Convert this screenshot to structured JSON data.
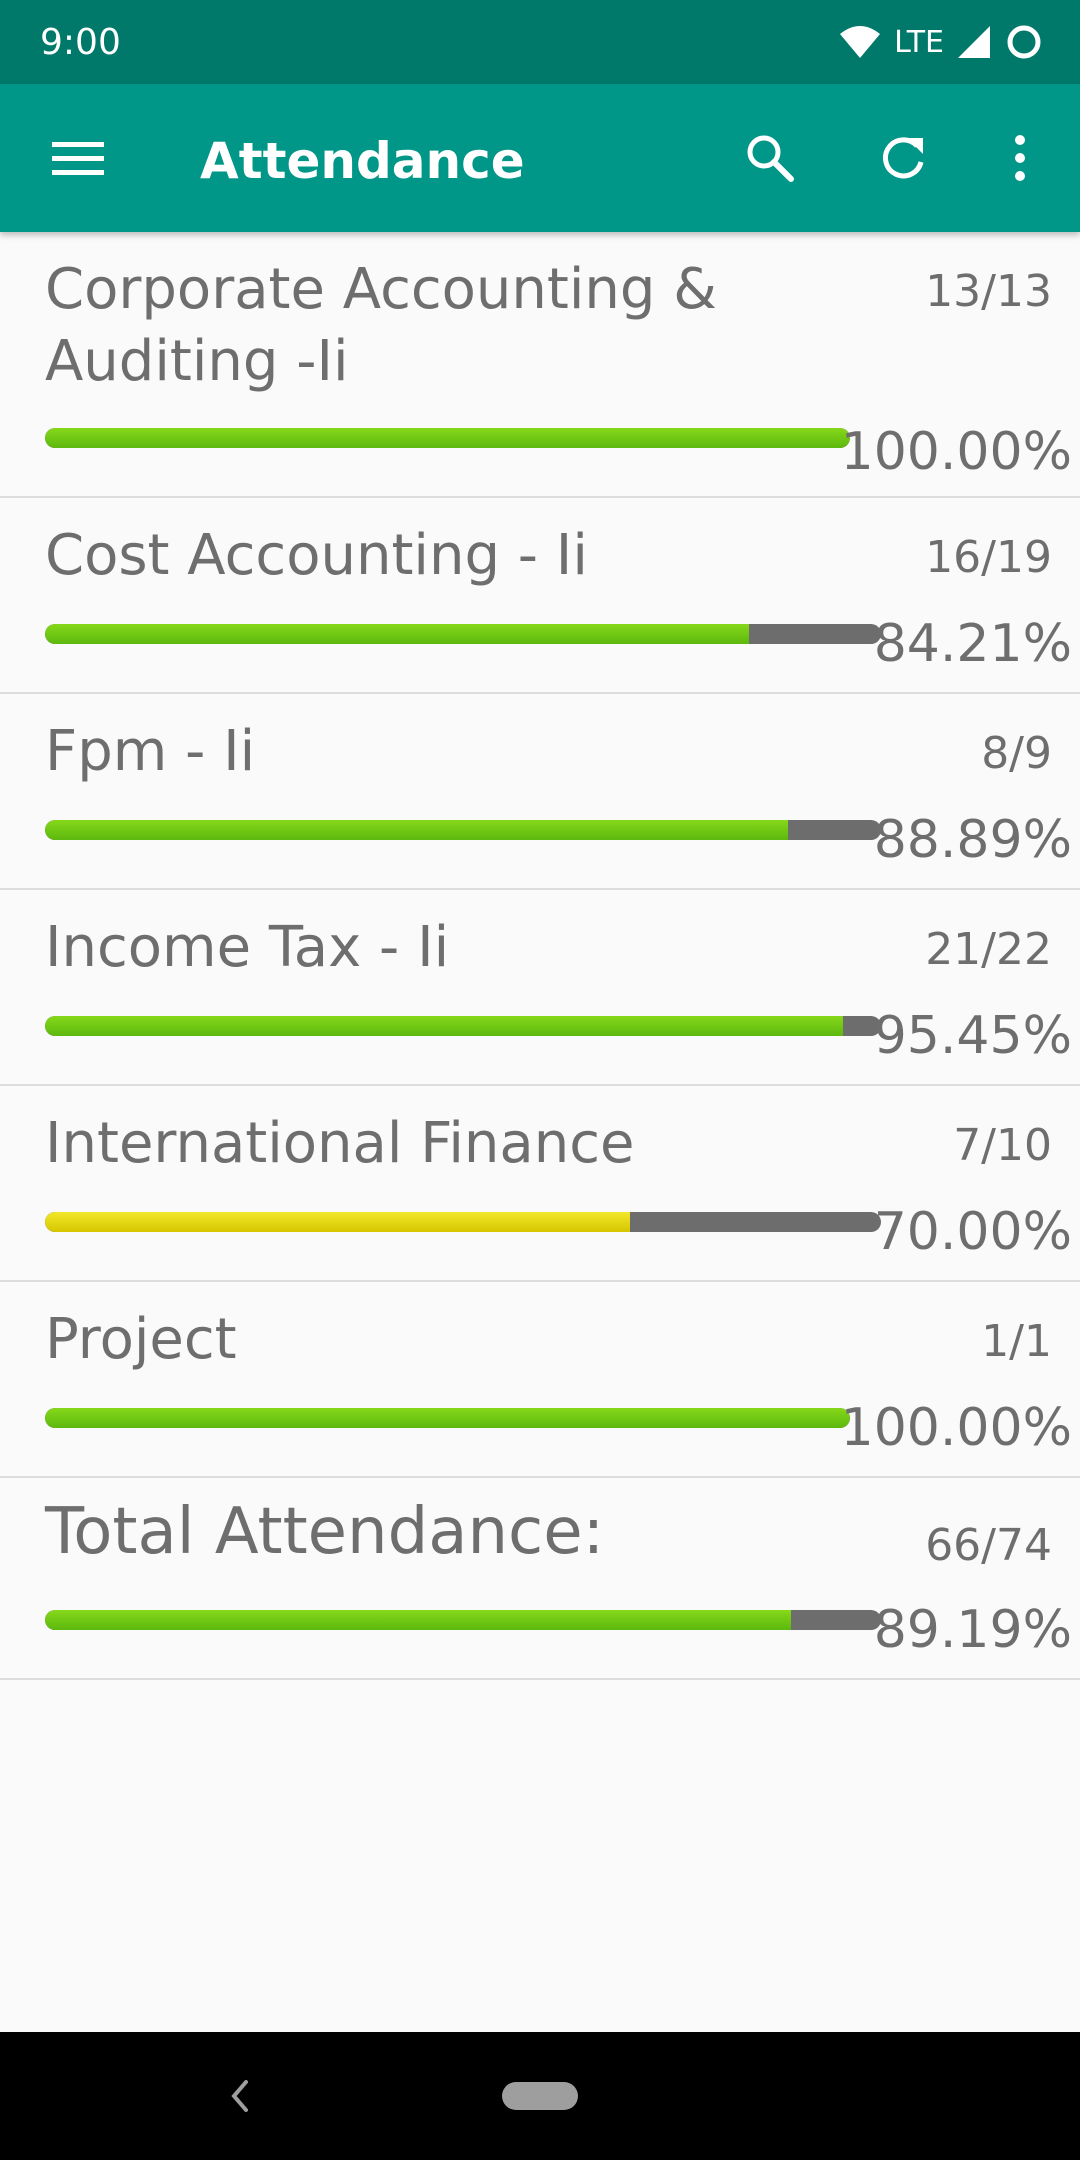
{
  "status_bar": {
    "time": "9:00",
    "network": "LTE"
  },
  "app_bar": {
    "title": "Attendance"
  },
  "subjects": [
    {
      "name": "Corporate Accounting & Auditing -Ii",
      "fraction": "13/13",
      "percent_text": "100.00%",
      "percent": 100.0,
      "color": "green"
    },
    {
      "name": "Cost Accounting - Ii",
      "fraction": "16/19",
      "percent_text": "84.21%",
      "percent": 84.21,
      "color": "green"
    },
    {
      "name": "Fpm - Ii",
      "fraction": "8/9",
      "percent_text": "88.89%",
      "percent": 88.89,
      "color": "green"
    },
    {
      "name": "Income Tax - Ii",
      "fraction": "21/22",
      "percent_text": "95.45%",
      "percent": 95.45,
      "color": "green"
    },
    {
      "name": "International Finance",
      "fraction": "7/10",
      "percent_text": "70.00%",
      "percent": 70.0,
      "color": "yellow"
    },
    {
      "name": "Project",
      "fraction": "1/1",
      "percent_text": "100.00%",
      "percent": 100.0,
      "color": "green"
    }
  ],
  "total": {
    "name": "Total Attendance:",
    "fraction": "66/74",
    "percent_text": "89.19%",
    "percent": 89.19,
    "color": "green"
  },
  "colors": {
    "status_bar": "#00796b",
    "app_bar": "#009688",
    "green": "#6fc812",
    "yellow": "#e8da10",
    "track": "#6d6d6d",
    "text": "#6e6e6e"
  }
}
